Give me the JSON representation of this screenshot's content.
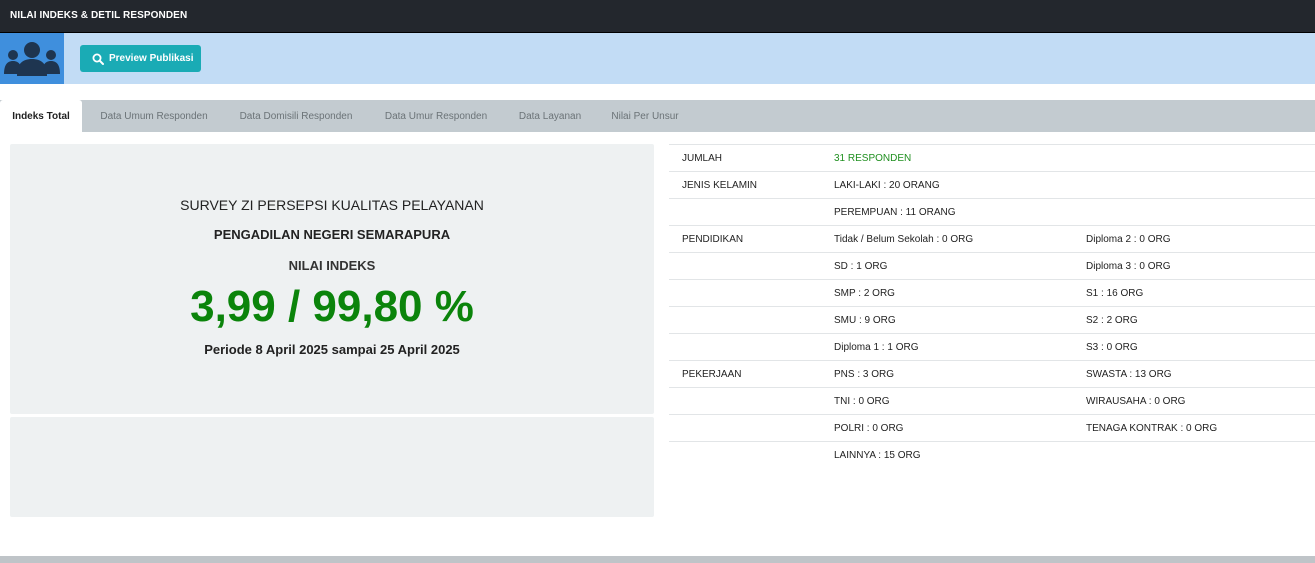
{
  "header": {
    "title": "NILAI INDEKS & DETIL RESPONDEN"
  },
  "banner": {
    "icon": "users-icon",
    "preview_label": "Preview Publikasi"
  },
  "tabs": [
    {
      "label": "Indeks Total",
      "active": true
    },
    {
      "label": "Data Umum Responden",
      "active": false
    },
    {
      "label": "Data Domisili Responden",
      "active": false
    },
    {
      "label": "Data Umur Responden",
      "active": false
    },
    {
      "label": "Data Layanan",
      "active": false
    },
    {
      "label": "Nilai Per Unsur",
      "active": false
    }
  ],
  "summary": {
    "survey": "SURVEY ZI PERSEPSI KUALITAS PELAYANAN",
    "court": "PENGADILAN NEGERI SEMARAPURA",
    "index_label": "NILAI INDEKS",
    "index_value": "3,99 / 99,80 %",
    "period": "Periode 8 April 2025 sampai 25 April 2025"
  },
  "details": {
    "rows": [
      [
        "JUMLAH",
        "31 RESPONDEN",
        ""
      ],
      [
        "JENIS KELAMIN",
        "LAKI-LAKI : 20 ORANG",
        ""
      ],
      [
        "",
        "PEREMPUAN : 11 ORANG",
        ""
      ],
      [
        "PENDIDIKAN",
        "Tidak / Belum Sekolah : 0 ORG",
        "Diploma 2 : 0 ORG"
      ],
      [
        "",
        "SD : 1 ORG",
        "Diploma 3 : 0 ORG"
      ],
      [
        "",
        "SMP : 2 ORG",
        "S1 : 16 ORG"
      ],
      [
        "",
        "SMU : 9 ORG",
        "S2 : 2 ORG"
      ],
      [
        "",
        "Diploma 1 : 1 ORG",
        "S3 : 0 ORG"
      ],
      [
        "PEKERJAAN",
        "PNS : 3 ORG",
        "SWASTA : 13 ORG"
      ],
      [
        "",
        "TNI : 0 ORG",
        "WIRAUSAHA : 0 ORG"
      ],
      [
        "",
        "POLRI : 0 ORG",
        "TENAGA KONTRAK : 0 ORG"
      ],
      [
        "",
        "LAINNYA : 15 ORG",
        ""
      ]
    ]
  },
  "colors": {
    "accent_green": "#0b840b",
    "button": "#1aabb5",
    "banner": "#c2dcf5"
  }
}
